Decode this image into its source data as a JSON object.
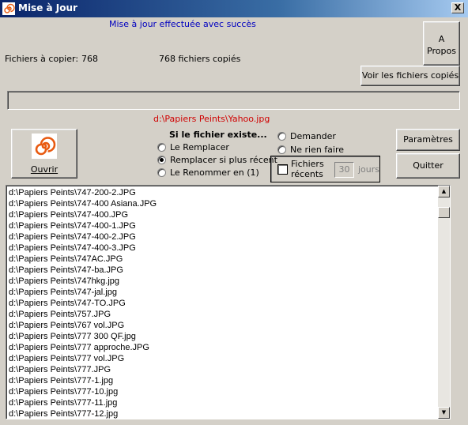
{
  "window": {
    "title": "Mise à Jour",
    "close_label": "X"
  },
  "status": {
    "message": "Mise à jour effectuée avec succès",
    "files_to_copy_label": "Fichiers à copier:",
    "files_to_copy_count": "768",
    "files_copied_text": "768 fichiers copiés",
    "current_file": "d:\\Papiers Peints\\Yahoo.jpg",
    "progress_percent": 0
  },
  "buttons": {
    "about_line1": "A",
    "about_line2": "Propos",
    "view_copied": "Voir les fichiers copiés",
    "open": "Ouvrir",
    "parameters": "Paramètres",
    "quit": "Quitter"
  },
  "options": {
    "heading": "Si le fichier existe...",
    "replace": "Le Remplacer",
    "replace_if_newer": "Remplacer si plus récent",
    "rename": "Le Renommer en (1)",
    "ask": "Demander",
    "do_nothing": "Ne rien faire",
    "selected": "replace_if_newer"
  },
  "recent": {
    "label_line1": "Fichiers",
    "label_line2": "récents",
    "days_value": "30",
    "days_label": "jours",
    "checked": false
  },
  "file_list": [
    "d:\\Papiers Peints\\747-200-2.JPG",
    "d:\\Papiers Peints\\747-400 Asiana.JPG",
    "d:\\Papiers Peints\\747-400.JPG",
    "d:\\Papiers Peints\\747-400-1.JPG",
    "d:\\Papiers Peints\\747-400-2.JPG",
    "d:\\Papiers Peints\\747-400-3.JPG",
    "d:\\Papiers Peints\\747AC.JPG",
    "d:\\Papiers Peints\\747-ba.JPG",
    "d:\\Papiers Peints\\747hkg.jpg",
    "d:\\Papiers Peints\\747-jal.jpg",
    "d:\\Papiers Peints\\747-TO.JPG",
    "d:\\Papiers Peints\\757.JPG",
    "d:\\Papiers Peints\\767 vol.JPG",
    "d:\\Papiers Peints\\777 300 QF.jpg",
    "d:\\Papiers Peints\\777 approche.JPG",
    "d:\\Papiers Peints\\777 vol.JPG",
    "d:\\Papiers Peints\\777.JPG",
    "d:\\Papiers Peints\\777-1.jpg",
    "d:\\Papiers Peints\\777-10.jpg",
    "d:\\Papiers Peints\\777-11.jpg",
    "d:\\Papiers Peints\\777-12.jpg"
  ]
}
